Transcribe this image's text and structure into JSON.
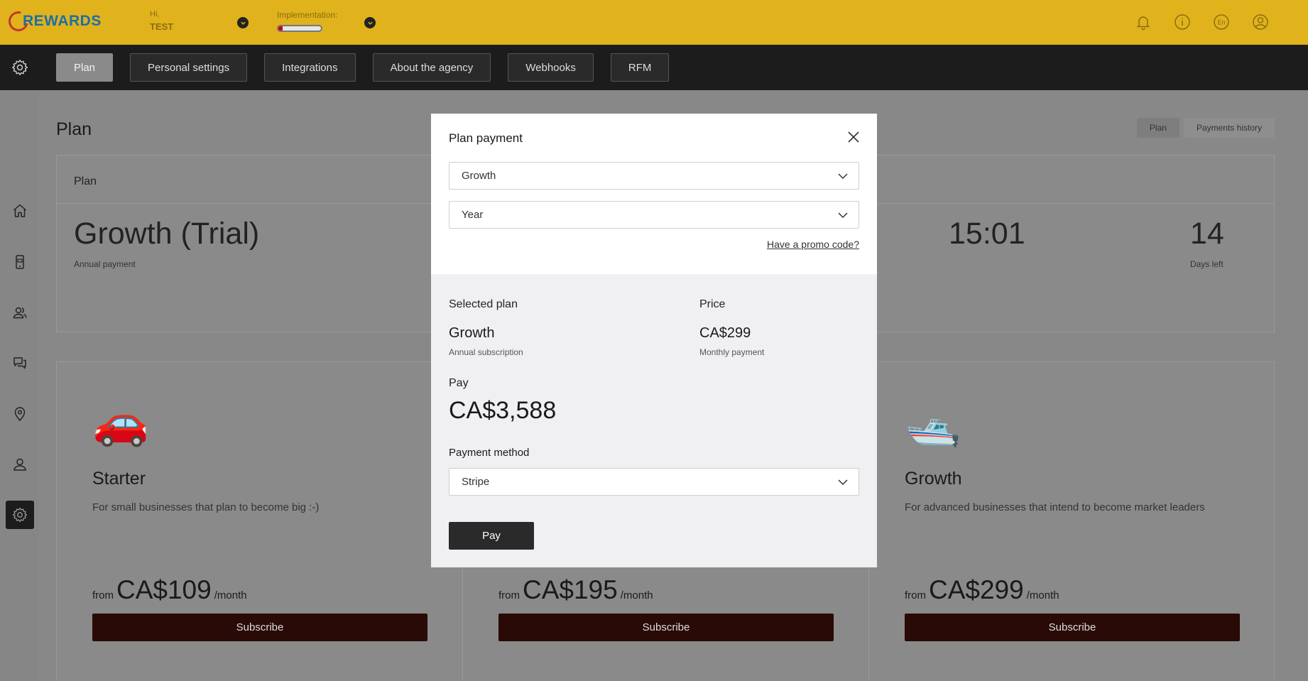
{
  "header": {
    "logo_text": "REWARDS",
    "greeting": "Hi,",
    "user_name": "TEST",
    "implementation_label": "Implementation:",
    "implementation_progress": 0.1,
    "icons": [
      "bell-icon",
      "info-icon",
      "language-icon",
      "user-icon"
    ],
    "language": "En",
    "brand_color": "#e0b21c"
  },
  "nav": {
    "tabs": [
      {
        "label": "Plan",
        "active": true
      },
      {
        "label": "Personal settings"
      },
      {
        "label": "Integrations"
      },
      {
        "label": "About the agency"
      },
      {
        "label": "Webhooks"
      },
      {
        "label": "RFM"
      }
    ]
  },
  "sidebar": {
    "items": [
      "home-icon",
      "mobile-card-icon",
      "customers-icon",
      "chat-icon",
      "location-icon",
      "profile-icon",
      "settings-icon"
    ],
    "active": "settings-icon"
  },
  "page": {
    "title": "Plan",
    "tabs": [
      {
        "label": "Plan",
        "active": true
      },
      {
        "label": "Payments history"
      }
    ],
    "plan_card": {
      "header": "Plan",
      "plan_name": "Growth (Trial)",
      "plan_sub": "Annual payment",
      "timer": "15:01",
      "days": "14",
      "days_label": "Days left"
    },
    "tiers": [
      {
        "emoji": "🚗",
        "name": "Starter",
        "desc": "For small businesses that plan to become big :-)",
        "from": "from",
        "price": "CA$109",
        "per": "/month",
        "button": "Subscribe"
      },
      {
        "emoji": "",
        "name": "",
        "desc": "",
        "from": "from",
        "price": "CA$195",
        "per": "/month",
        "button": "Subscribe"
      },
      {
        "emoji": "🛥️",
        "name": "Growth",
        "desc": "For advanced businesses that intend to become market leaders",
        "from": "from",
        "price": "CA$299",
        "per": "/month",
        "button": "Subscribe"
      }
    ]
  },
  "modal": {
    "title": "Plan payment",
    "plan_select": "Growth",
    "period_select": "Year",
    "promo_link": "Have a promo code?",
    "selected_plan_label": "Selected plan",
    "selected_plan": "Growth",
    "selected_plan_sub": "Annual subscription",
    "price_label": "Price",
    "price": "CA$299",
    "price_sub": "Monthly payment",
    "pay_label": "Pay",
    "pay_amount": "CA$3,588",
    "payment_method_label": "Payment method",
    "payment_method": "Stripe",
    "pay_button": "Pay"
  }
}
